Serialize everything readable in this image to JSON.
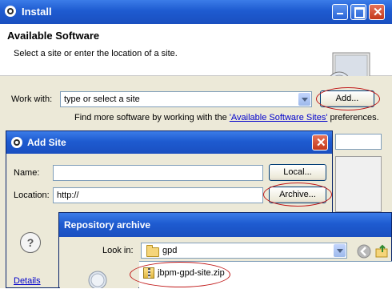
{
  "install": {
    "title": "Install",
    "header_title": "Available Software",
    "header_subtitle": "Select a site or enter the location of a site.",
    "work_with_label": "Work with:",
    "work_with_value": "type or select a site",
    "add_button": "Add...",
    "find_more_prefix": "Find more software by working with the ",
    "find_more_link": "'Available Software Sites'",
    "find_more_suffix": " preferences.",
    "details_link": "Details"
  },
  "add_site": {
    "title": "Add Site",
    "name_label": "Name:",
    "name_value": "",
    "local_button": "Local...",
    "location_label": "Location:",
    "location_value": "http://",
    "archive_button": "Archive...",
    "help_symbol": "?"
  },
  "repo_archive": {
    "title": "Repository archive",
    "look_in_label": "Look in:",
    "look_in_value": "gpd",
    "file_name": "jbpm-gpd-site.zip"
  },
  "colors": {
    "titlebar": "#1e5bd0",
    "dialog_bg": "#ece9d8",
    "highlight_oval": "#c01818",
    "link": "#0000cc"
  }
}
